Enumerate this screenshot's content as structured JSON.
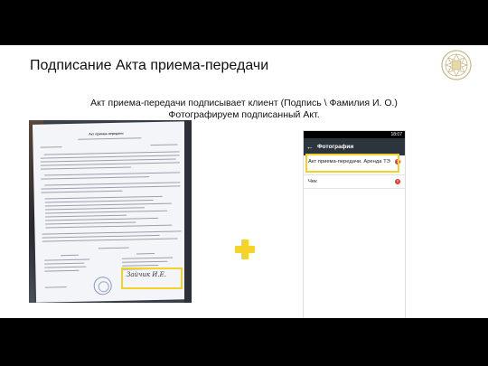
{
  "slide": {
    "title": "Подписание Акта приема-передачи",
    "subtitle": "Акт приема-передачи подписывает клиент (Подпись \\ Фамилия И. О.) Фотографируем подписанный Акт.",
    "accent_color": "#f5d327"
  },
  "document_photo": {
    "header_text": "Акт приема-передачи",
    "signature_text": "Зайчик И.Е."
  },
  "phone": {
    "status_time": "18:07",
    "app_bar_title": "Фотографии",
    "items": [
      {
        "label": "Акт приема-передачи. Аренда ТЭ",
        "badge": "!"
      },
      {
        "label": "Чек",
        "badge": "!"
      }
    ]
  },
  "icons": [
    "logo-icon",
    "plus-icon",
    "back-arrow-icon",
    "error-icon"
  ]
}
